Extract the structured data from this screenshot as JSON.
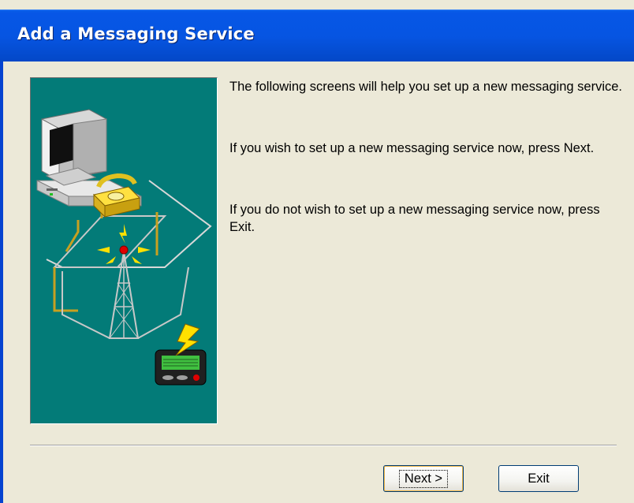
{
  "window": {
    "title": "Add a Messaging Service"
  },
  "content": {
    "paragraphs": [
      "The following screens will help you set up a new messaging service.",
      "If you wish to set up a new messaging service now, press Next.",
      "If you do not wish to set up a new messaging service now, press Exit."
    ]
  },
  "buttons": {
    "next_label": "Next >",
    "exit_label": "Exit"
  },
  "colors": {
    "titlebar": "#0655e2",
    "illustration_bg": "#037b78",
    "dialog_bg": "#ece9d8"
  },
  "illustration": {
    "icons": [
      "computer-icon",
      "telephone-icon",
      "antenna-tower-icon",
      "pager-icon",
      "lightning-bolt-icon"
    ]
  }
}
